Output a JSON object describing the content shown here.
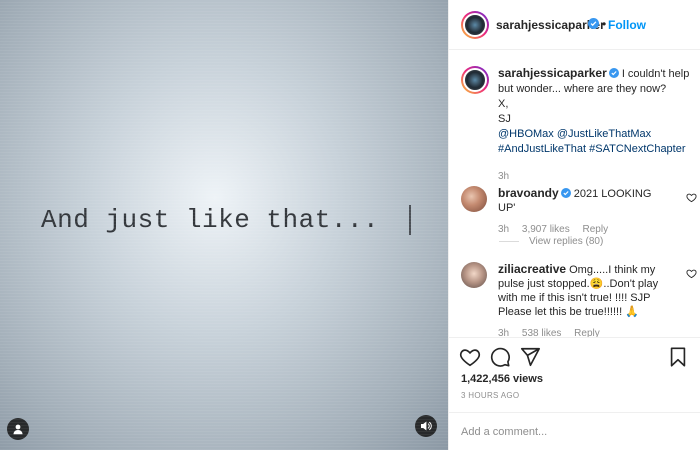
{
  "media": {
    "text": "And just like that...",
    "icons": {
      "user": "user-icon",
      "sound": "speaker-icon"
    }
  },
  "header": {
    "username": "sarahjessicaparker",
    "separator": "•",
    "follow_label": "Follow"
  },
  "caption": {
    "username": "sarahjessicaparker",
    "line1": "I couldn't help but wonder... where are they now?",
    "line2": "X,",
    "line3": "SJ",
    "mention1": "@HBOMax",
    "mention2": "@JustLikeThatMax",
    "hashtag1": "#AndJustLikeThat",
    "hashtag2": "#SATCNextChapter",
    "time": "3h"
  },
  "comments": [
    {
      "username": "bravoandy",
      "text": "2021 LOOKING UP'",
      "time": "3h",
      "likes": "3,907 likes",
      "reply_label": "Reply",
      "view_replies": "View replies (80)"
    },
    {
      "username": "ziliacreative",
      "text": "Omg.....I think my pulse just stopped.😩..Don't play with me if this isn't true! !!!! SJP Please let this be true!!!!!! 🙏",
      "time": "3h",
      "likes": "538 likes",
      "reply_label": "Reply"
    }
  ],
  "actions": {
    "views": "1,422,456 views",
    "posted_ago": "3 HOURS AGO"
  },
  "comment_input": {
    "placeholder": "Add a comment..."
  },
  "colors": {
    "link": "#00376b",
    "follow": "#0095f6",
    "verified": "#3897f0",
    "muted": "#8e8e8e"
  }
}
